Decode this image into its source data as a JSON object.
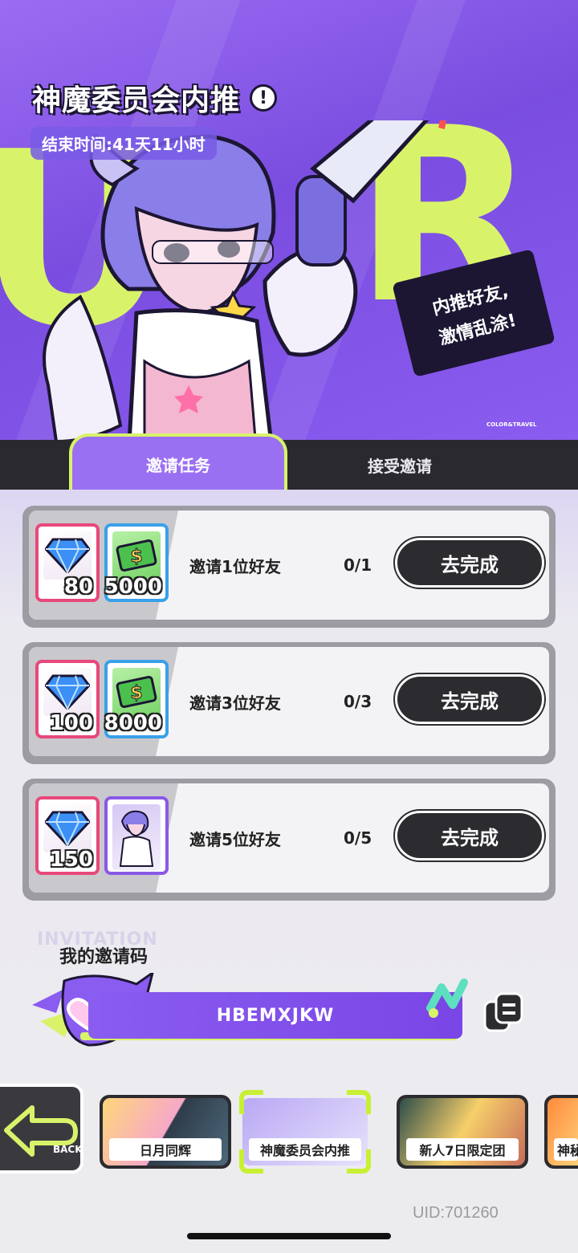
{
  "banner": {
    "title": "神魔委员会内推",
    "end_time": "结束时间:41天11小时",
    "speech_line1": "内推好友,",
    "speech_line2": "激情乱涂!",
    "brand_tag": "COLOR&TRAVEL"
  },
  "tabs": [
    {
      "label": "邀请任务",
      "active": true
    },
    {
      "label": "接受邀请",
      "active": false
    }
  ],
  "tasks": [
    {
      "rewards": [
        {
          "icon": "diamond-icon",
          "qty": "80"
        },
        {
          "icon": "cash-icon",
          "qty": "5000"
        }
      ],
      "label": "邀请1位好友",
      "progress": "0/1",
      "button": "去完成"
    },
    {
      "rewards": [
        {
          "icon": "diamond-icon",
          "qty": "100"
        },
        {
          "icon": "cash-icon",
          "qty": "8000"
        }
      ],
      "label": "邀请3位好友",
      "progress": "0/3",
      "button": "去完成"
    },
    {
      "rewards": [
        {
          "icon": "diamond-icon",
          "qty": "150"
        },
        {
          "icon": "character-card-icon",
          "qty": ""
        }
      ],
      "label": "邀请5位好友",
      "progress": "0/5",
      "button": "去完成"
    }
  ],
  "invitation": {
    "bg_text": "INVITATION",
    "title": "我的邀请码",
    "code": "HBEMXJKW"
  },
  "nav": {
    "back_label": "BACK",
    "items": [
      {
        "label": "日月同辉",
        "active": false
      },
      {
        "label": "神魔委员会内推",
        "active": true
      },
      {
        "label": "新人7日限定团",
        "active": false
      },
      {
        "label": "神秘",
        "active": false
      }
    ]
  },
  "uid": "UID:701260",
  "colors": {
    "accent_purple": "#8a5cf0",
    "accent_lime": "#d8f36a",
    "button_dark": "#2c2c30",
    "gem_frame": "#e8487a",
    "cash_frame": "#3aa0e8"
  }
}
